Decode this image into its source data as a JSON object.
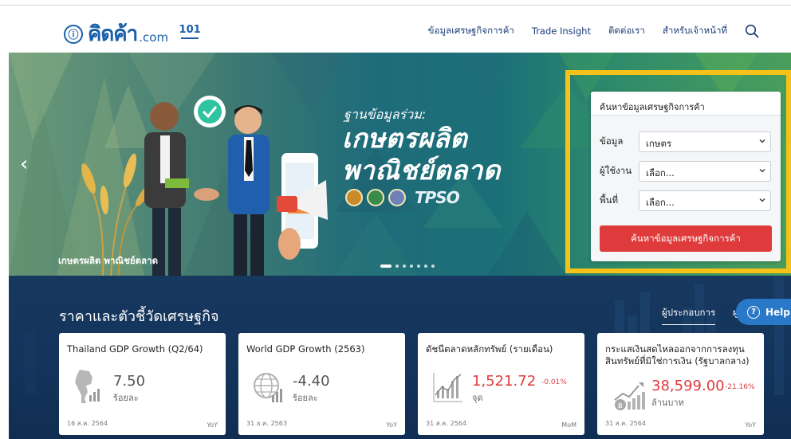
{
  "header": {
    "logo_glyph": "ⓘ",
    "logo_text": "คิดค้า",
    "logo_suffix": ".com",
    "ministry_mark": "101",
    "nav": [
      "ข้อมูลเศรษฐกิจการค้า",
      "Trade Insight",
      "ติดต่อเรา",
      "สำหรับเจ้าหน้าที่"
    ],
    "search_icon": "search-icon"
  },
  "hero": {
    "subtitle": "ฐานข้อมูลร่วม:",
    "title_line1": "เกษตรผลิต",
    "title_line2": "พาณิชย์ตลาด",
    "partner_mark": "TPSO",
    "caption": "เกษตรผลิต พาณิชย์ตลาด",
    "prev_arrow": "‹",
    "slides": 7,
    "active_slide": 1
  },
  "search_form": {
    "heading": "ค้นหาข้อมูลเศรษฐกิจการค้า",
    "fields": [
      {
        "label": "ข้อมูล",
        "value": "เกษตร"
      },
      {
        "label": "ผู้ใช้งาน",
        "value": "เลือก..."
      },
      {
        "label": "พื้นที่",
        "value": "เลือก..."
      }
    ],
    "submit_label": "ค้นหาข้อมูลเศรษฐกิจการค้า",
    "highlight_color": "#f6c21a",
    "button_color": "#e03b3c"
  },
  "economy": {
    "title": "ราคาและตัวชี้วัดเศรษฐกิจ",
    "tab_active": "ผู้ประกอบการ",
    "tab_next": "ผู",
    "help_label": "Help",
    "cards": [
      {
        "title": "Thailand GDP Growth (Q2/64)",
        "value": "7.50",
        "unit": "ร้อยละ",
        "change": "",
        "date": "16 ส.ค. 2564",
        "period": "YoY",
        "icon": "thailand-map-icon"
      },
      {
        "title": "World GDP Growth (2563)",
        "value": "-4.40",
        "unit": "ร้อยละ",
        "change": "",
        "date": "31 ธ.ค. 2563",
        "period": "YoY",
        "icon": "globe-chart-icon"
      },
      {
        "title": "ดัชนีตลาดหลักทรัพย์ (รายเดือน)",
        "value": "1,521.72",
        "unit": "จุด",
        "change": "-0.01%",
        "date": "31 ส.ค. 2564",
        "period": "MoM",
        "icon": "stock-chart-icon"
      },
      {
        "title": "กระแสเงินสดไหลออกจากการลงทุนสินทรัพย์ที่มิใช่การเงิน (รัฐบาลกลาง)",
        "value": "38,599.00",
        "unit": "ล้านบาท",
        "change": "-21.16%",
        "date": "31 ส.ค. 2564",
        "period": "YoY",
        "icon": "money-growth-icon"
      }
    ]
  }
}
